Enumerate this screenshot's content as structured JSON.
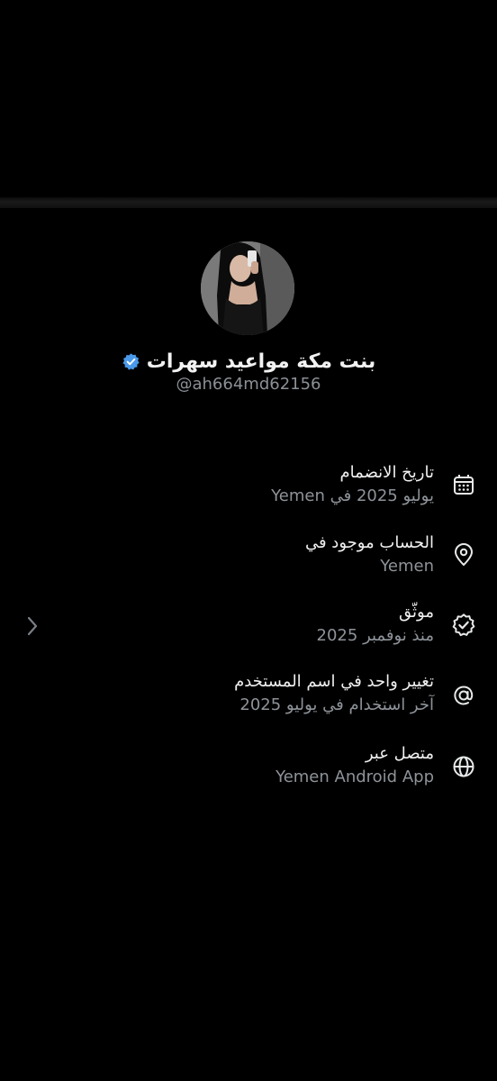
{
  "profile": {
    "display_name": "بنت مكة مواعيد سهرات",
    "handle": "@ah664md62156",
    "verified": true,
    "badge_color": "#4a99e9"
  },
  "info_items": [
    {
      "icon": "calendar-icon",
      "title": "تاريخ الانضمام",
      "subtitle": "يوليو 2025 في Yemen"
    },
    {
      "icon": "location-pin-icon",
      "title": "الحساب موجود في",
      "subtitle": "Yemen"
    },
    {
      "icon": "verified-check-icon",
      "title": "موثّق",
      "subtitle": "منذ نوفمبر 2025"
    },
    {
      "icon": "at-sign-icon",
      "title": "تغيير واحد في اسم المستخدم",
      "subtitle": "آخر استخدام في يوليو 2025"
    },
    {
      "icon": "globe-icon",
      "title": "متصل عبر",
      "subtitle": "Yemen Android App"
    }
  ],
  "navigation": {
    "chevron": "chevron-left-icon"
  },
  "colors": {
    "background": "#000000",
    "primary_text": "#e7e9ea",
    "secondary_text": "#8e9399"
  }
}
